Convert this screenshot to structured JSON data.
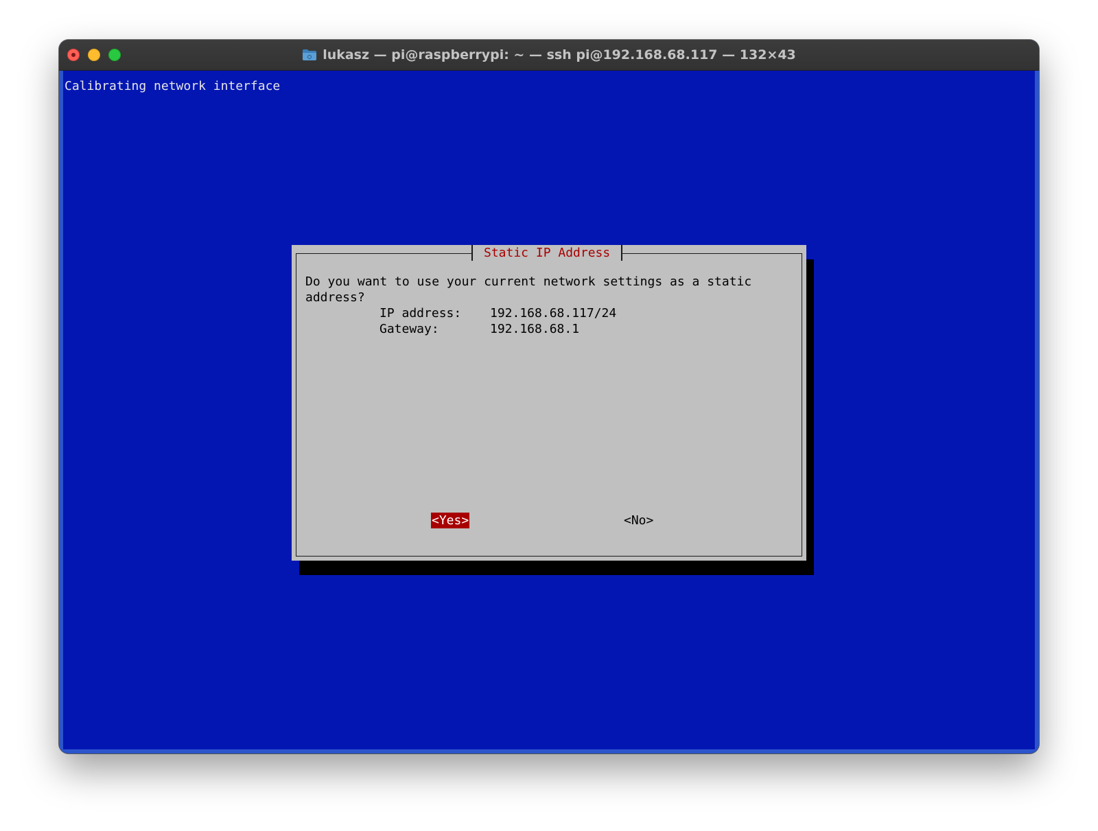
{
  "window": {
    "title": "lukasz — pi@raspberrypi: ~ — ssh pi@192.168.68.117 — 132×43"
  },
  "terminal": {
    "status_line": "Calibrating network interface"
  },
  "dialog": {
    "title": "Static IP Address",
    "message_line1": "Do you want to use your current network settings as a static",
    "message_line2": "address?",
    "ip_label": "IP address:",
    "ip_value": "192.168.68.117/24",
    "gateway_label": "Gateway:",
    "gateway_value": "192.168.68.1",
    "yes_button": "<Yes>",
    "no_button": "<No>"
  },
  "colors": {
    "terminal_bg": "#0416b2",
    "dialog_bg": "#c0c0c0",
    "dialog_title": "#a80000",
    "selected_button_bg": "#a80000"
  }
}
